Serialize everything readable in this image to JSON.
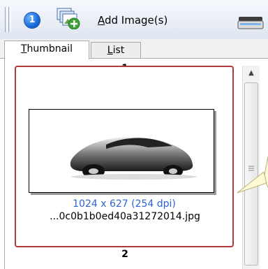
{
  "toolbar": {
    "step_number": "1",
    "add_button_label_prefix": "",
    "add_button_label_accel": "A",
    "add_button_label_rest": "dd Image(s)"
  },
  "tabs": [
    {
      "accel": "T",
      "rest": "humbnail",
      "active": true
    },
    {
      "accel": "L",
      "rest": "ist",
      "active": false
    }
  ],
  "images": [
    {
      "number": "1",
      "dims": "1024 x 627 (254 dpi)",
      "filename": "...0c0b1b0ed40a31272014.jpg"
    }
  ],
  "next_number": "2",
  "colors": {
    "selection_border": "#b43a3a",
    "dims_text": "#2e63d2",
    "badge": "#0a5fd0"
  }
}
